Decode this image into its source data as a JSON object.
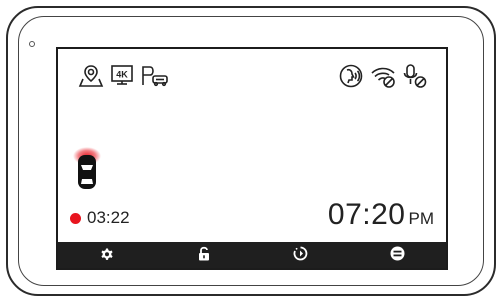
{
  "status_icons": {
    "left": [
      "gps-icon",
      "4k-resolution-icon",
      "parking-mode-icon"
    ],
    "right": [
      "voice-control-icon",
      "wifi-off-icon",
      "microphone-off-icon"
    ]
  },
  "recording": {
    "indicator_color": "#e8141e",
    "elapsed": "03:22"
  },
  "clock": {
    "time": "07:20",
    "ampm": "PM"
  },
  "resolution_badge": "4K",
  "toolbar": {
    "buttons": [
      "settings-icon",
      "unlock-icon",
      "timelapse-icon",
      "menu-icon"
    ]
  },
  "colors": {
    "screen_background": "#ffffff",
    "toolbar_background": "#1f1f1f",
    "accent_red": "#e8141e"
  }
}
